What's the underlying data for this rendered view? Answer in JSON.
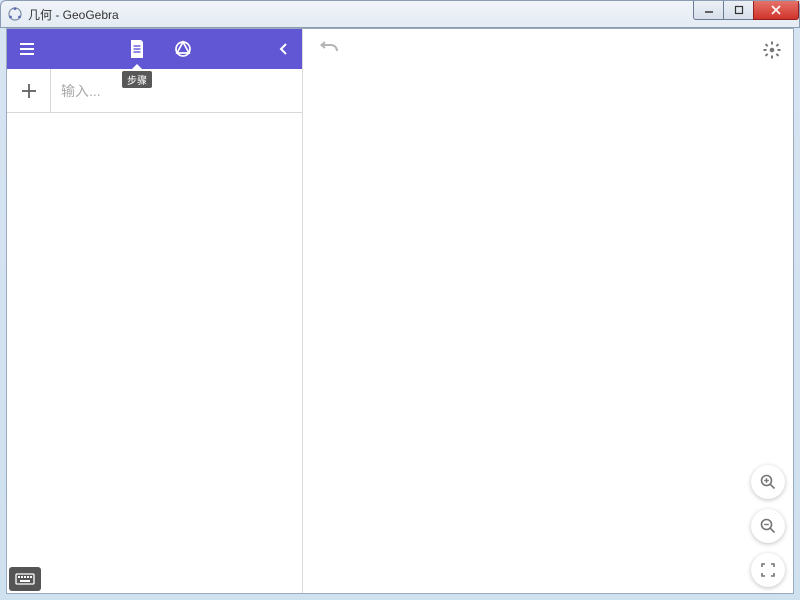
{
  "window": {
    "title": "几何 - GeoGebra"
  },
  "toolbar": {
    "tooltip_steps": "步骤"
  },
  "input": {
    "placeholder": "输入..."
  },
  "colors": {
    "accent": "#6157d5"
  }
}
